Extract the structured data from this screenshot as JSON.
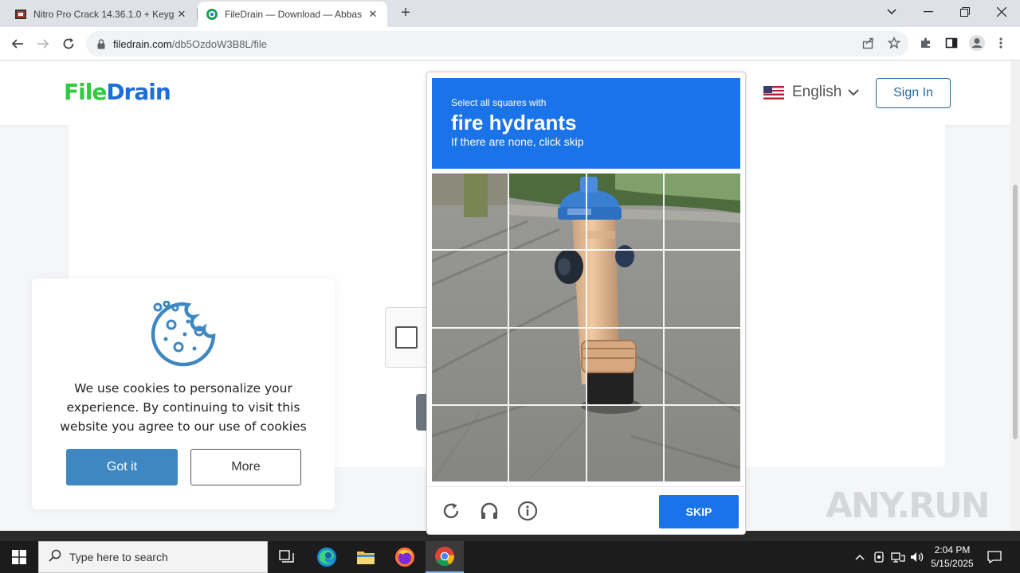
{
  "browser": {
    "tabs": [
      {
        "title": "Nitro Pro Crack 14.36.1.0 + Keyg",
        "active": false
      },
      {
        "title": "FileDrain — Download — Abbas",
        "active": true
      }
    ],
    "url_domain": "filedrain.com",
    "url_path": "/db5OzdoW3B8L/file"
  },
  "site": {
    "logo_part1": "File",
    "logo_part2": "Drain",
    "language": "English",
    "sign_in": "Sign In"
  },
  "cookie": {
    "message": "We use cookies to personalize your experience. By continuing to visit this website you agree to our use of cookies",
    "accept_label": "Got it",
    "more_label": "More"
  },
  "captcha": {
    "instruction_small": "Select all squares with",
    "target": "fire hydrants",
    "instruction_sub": "If there are none, click skip",
    "skip_label": "SKIP",
    "grid_rows": 4,
    "grid_cols": 4,
    "accent_color": "#1a73e8"
  },
  "watermark": "ANY.RUN",
  "taskbar": {
    "search_placeholder": "Type here to search",
    "time": "2:04 PM",
    "date": "5/15/2025"
  }
}
